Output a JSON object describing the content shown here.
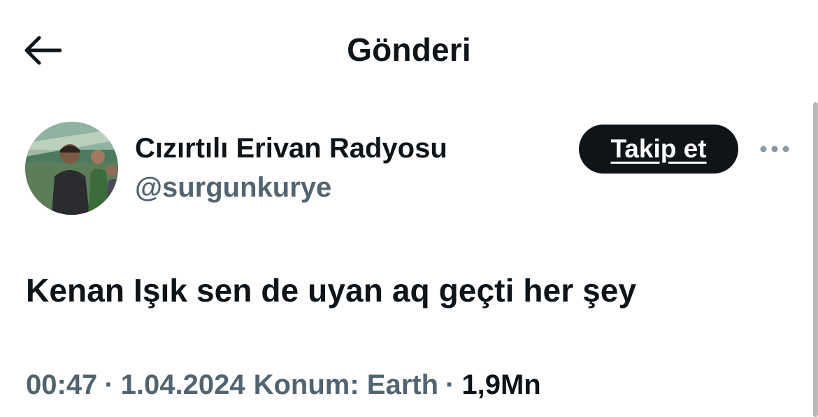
{
  "header": {
    "back_icon": "arrow-left-icon",
    "title": "Gönderi"
  },
  "author": {
    "avatar_icon": "profile-photo",
    "display_name": "Cızırtılı Erivan Radyosu",
    "handle": "@surgunkurye",
    "follow_label": "Takip et",
    "more_icon": "more-horizontal-icon"
  },
  "tweet": {
    "text": "Kenan Işık sen de uyan aq geçti her şey"
  },
  "meta": {
    "time": "00:47",
    "date": "1.04.2024",
    "location": "Konum: Earth",
    "separator": "·",
    "views": "1,9Mn"
  },
  "colors": {
    "primary_text": "#0f1419",
    "secondary_text": "#536471",
    "button_bg": "#0f1419",
    "button_text": "#ffffff"
  }
}
